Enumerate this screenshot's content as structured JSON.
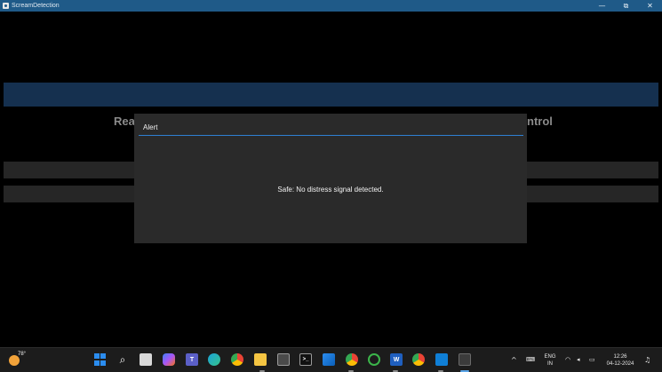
{
  "window": {
    "title": "ScreamDetection",
    "minimize_glyph": "—",
    "restore_glyph": "⧉",
    "close_glyph": "✕"
  },
  "app": {
    "heading_left": "Rea",
    "heading_right": "ntrol"
  },
  "dialog": {
    "title": "Alert",
    "message": "Safe: No distress signal detected."
  },
  "taskbar": {
    "weather_temp": "78°",
    "apps": [
      {
        "name": "start",
        "icon": "windows-logo-icon"
      },
      {
        "name": "search",
        "icon": "search-icon",
        "glyph": "⌕"
      },
      {
        "name": "task-view",
        "icon": "task-view-icon"
      },
      {
        "name": "copilot",
        "icon": "copilot-icon"
      },
      {
        "name": "teams",
        "icon": "teams-icon",
        "glyph": "T"
      },
      {
        "name": "edge",
        "icon": "edge-icon"
      },
      {
        "name": "chrome",
        "icon": "chrome-icon"
      },
      {
        "name": "file-explorer",
        "icon": "folder-icon"
      },
      {
        "name": "camera",
        "icon": "camera-icon"
      },
      {
        "name": "terminal",
        "icon": "terminal-icon",
        "glyph": ">_"
      },
      {
        "name": "photos",
        "icon": "photos-icon"
      },
      {
        "name": "chrome-profile",
        "icon": "chrome-icon"
      },
      {
        "name": "circle-app",
        "icon": "ring-icon"
      },
      {
        "name": "word",
        "icon": "word-icon",
        "glyph": "W"
      },
      {
        "name": "chrome-2",
        "icon": "chrome-icon"
      },
      {
        "name": "vscode",
        "icon": "vscode-icon"
      },
      {
        "name": "python-app",
        "icon": "python-icon"
      }
    ],
    "tray": {
      "chevron": "^",
      "lang_top": "ENG",
      "lang_bottom": "IN",
      "time": "12:26",
      "date": "04-12-2024"
    }
  },
  "colors": {
    "titlebar": "#1f5a88",
    "banner": "#15304f",
    "dialog_bg": "#2a2a2a",
    "dialog_accent": "#2f7fd2",
    "taskbar": "#1c1c1c"
  }
}
